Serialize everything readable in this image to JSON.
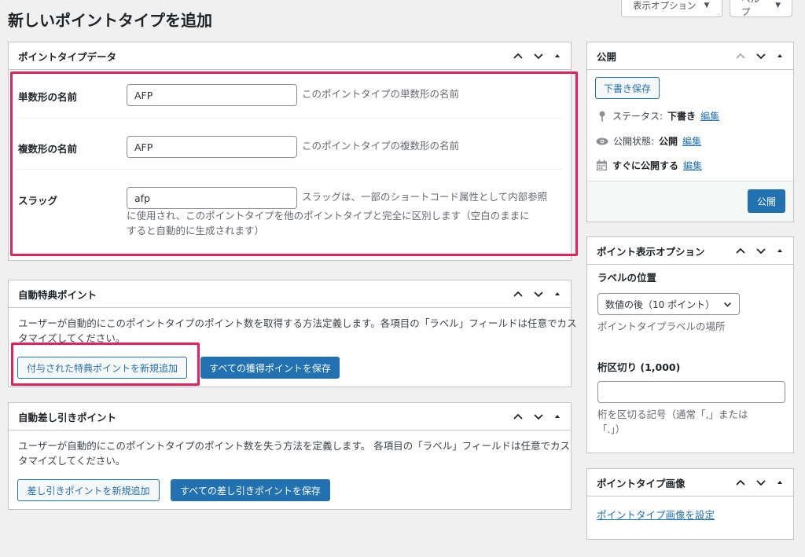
{
  "header": {
    "title": "新しいポイントタイプを追加",
    "screen_options": "表示オプション",
    "help": "ヘルプ"
  },
  "point_type_data": {
    "title": "ポイントタイプデータ",
    "singular_label": "単数形の名前",
    "singular_value": "AFP",
    "singular_desc": "このポイントタイプの単数形の名前",
    "plural_label": "複数形の名前",
    "plural_value": "AFP",
    "plural_desc": "このポイントタイプの複数形の名前",
    "slug_label": "スラッグ",
    "slug_value": "afp",
    "slug_desc_1": "スラッグは、一部のショートコード属性として内部参照",
    "slug_desc_2": "に使用され、このポイントタイプを他のポイントタイプと完全に区別します（空白のままに",
    "slug_desc_3": "すると自動的に生成されます）"
  },
  "auto_award": {
    "title": "自動特典ポイント",
    "desc_1": "ユーザーが自動的にこのポイントタイプのポイント数を取得する方法定義します。各項目の「ラベル」フィールドは任意でカス",
    "desc_2": "タマイズしてください。",
    "add_button": "付与された特典ポイントを新規追加",
    "save_button": "すべての獲得ポイントを保存"
  },
  "auto_deduct": {
    "title": "自動差し引きポイント",
    "desc_1": "ユーザーが自動的にこのポイントタイプのポイント数を失う方法を定義します。 各項目の「ラベル」フィールドは任意でカス",
    "desc_2": "タマイズしてください。",
    "add_button": "差し引きポイントを新規追加",
    "save_button": "すべての差し引きポイントを保存"
  },
  "publish": {
    "title": "公開",
    "save_draft": "下書き保存",
    "status_label": "ステータス:",
    "status_value": "下書き",
    "visibility_label": "公開状態:",
    "visibility_value": "公開",
    "schedule_text": "すぐに公開する",
    "edit": "編集",
    "publish_button": "公開"
  },
  "display_options": {
    "title": "ポイント表示オプション",
    "label_position_title": "ラベルの位置",
    "label_position_value": "数値の後（10 ポイント）",
    "label_position_desc": "ポイントタイプラベルの場所",
    "thousands_title": "桁区切り (1,000)",
    "thousands_value": "",
    "thousands_desc_1": "桁を区切る記号（通常「,」または",
    "thousands_desc_2": "「.」）"
  },
  "image": {
    "title": "ポイントタイプ画像",
    "set_link": "ポイントタイプ画像を設定"
  },
  "colors": {
    "accent": "#2271b1",
    "highlight": "#e5205d",
    "background": "#f0f0f1"
  }
}
